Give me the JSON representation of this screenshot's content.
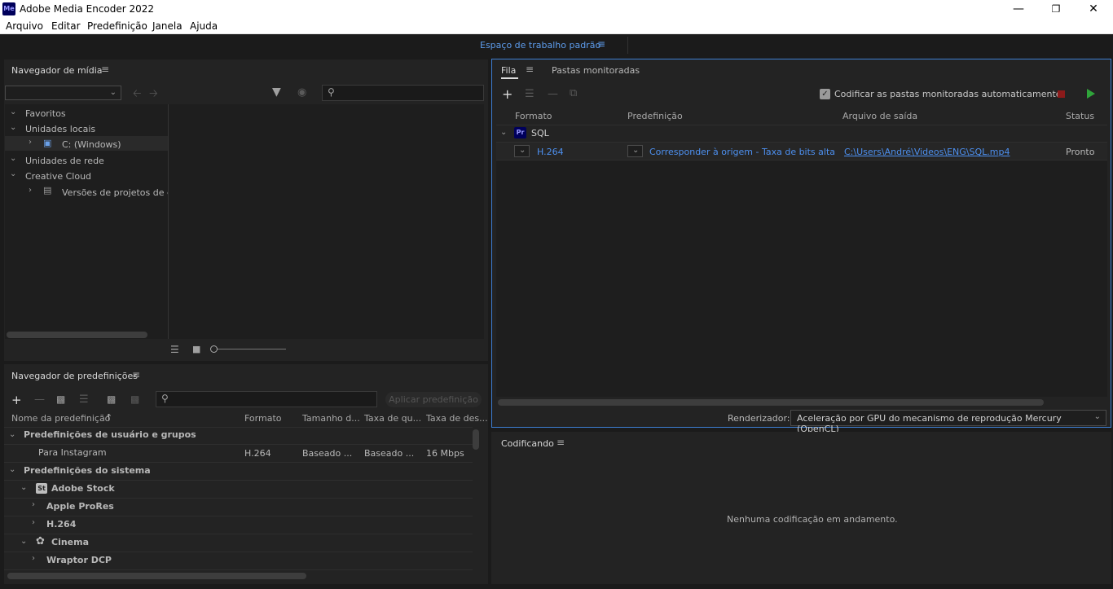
{
  "window": {
    "title": "Adobe Media Encoder 2022",
    "icon_text": "Me",
    "controls": [
      "minimize-icon",
      "restore-icon",
      "close-icon"
    ]
  },
  "menu": [
    "Arquivo",
    "Editar",
    "Predefinição",
    "Janela",
    "Ajuda"
  ],
  "workspace": {
    "label": "Espaço de trabalho padrão"
  },
  "media_browser": {
    "title": "Navegador de mídia",
    "tree": [
      {
        "label": "Favoritos",
        "level": 0,
        "expanded": true
      },
      {
        "label": "Unidades locais",
        "level": 0,
        "expanded": true
      },
      {
        "label": "C: (Windows)",
        "level": 1,
        "expanded": false
      },
      {
        "label": "Unidades de rede",
        "level": 0,
        "expanded": true
      },
      {
        "label": "Creative Cloud",
        "level": 0,
        "expanded": true
      },
      {
        "label": "Versões de projetos de eq",
        "level": 1,
        "expanded": false
      }
    ]
  },
  "preset_browser": {
    "title": "Navegador de predefinições",
    "apply_button": "Aplicar predefinição",
    "columns": [
      "Nome da predefinição",
      "Formato",
      "Tamanho d...",
      "Taxa de qu...",
      "Taxa de des..."
    ],
    "groups": {
      "user": "Predefinições de usuário e grupos",
      "user_row": {
        "name": "Para Instagram",
        "format": "H.264",
        "size": "Baseado ...",
        "quality": "Baseado ...",
        "rate": "16 Mbps"
      },
      "system": "Predefinições do sistema",
      "adobe_stock": "Adobe Stock",
      "adobe_stock_icon": "St",
      "apple_prores": "Apple ProRes",
      "h264": "H.264",
      "cinema": "Cinema",
      "wraptor": "Wraptor DCP"
    }
  },
  "queue": {
    "tab_queue": "Fila",
    "tab_watch": "Pastas monitoradas",
    "auto_encode_label": "Codificar as pastas monitoradas automaticamente",
    "auto_encode_checked": true,
    "columns": [
      "Formato",
      "Predefinição",
      "Arquivo de saída",
      "Status"
    ],
    "item": {
      "name": "SQL",
      "icon": "Pr",
      "format": "H.264",
      "preset": "Corresponder à origem - Taxa de bits alta",
      "output": "C:\\Users\\André\\Videos\\ENG\\SQL.mp4",
      "status": "Pronto"
    },
    "renderer_label": "Renderizador:",
    "renderer_value": "Aceleração por GPU do mecanismo de reprodução Mercury (OpenCL)"
  },
  "encoding": {
    "title": "Codificando",
    "empty_message": "Nenhuma codificação em andamento."
  },
  "colors": {
    "accent": "#4d90f0",
    "stop": "#8b1a1a",
    "start": "#2fa43a"
  }
}
